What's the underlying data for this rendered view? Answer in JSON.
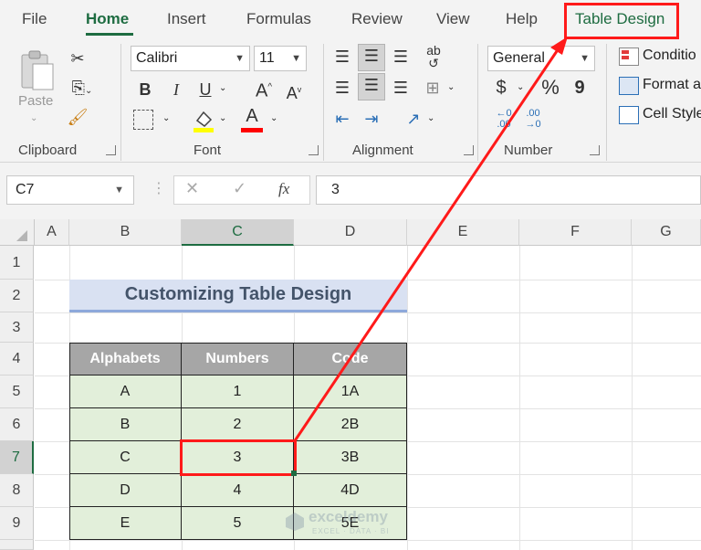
{
  "tabs": [
    {
      "label": "File"
    },
    {
      "label": "Home"
    },
    {
      "label": "Insert"
    },
    {
      "label": "Formulas"
    },
    {
      "label": "Review"
    },
    {
      "label": "View"
    },
    {
      "label": "Help"
    },
    {
      "label": "Table Design"
    }
  ],
  "ribbon": {
    "clipboard": {
      "paste_label": "Paste",
      "group_label": "Clipboard"
    },
    "font": {
      "font_name": "Calibri",
      "font_size": "11",
      "bold": "B",
      "italic": "I",
      "underline": "U",
      "grow": "A",
      "shrink": "A",
      "font_color": "A",
      "group_label": "Font"
    },
    "alignment": {
      "group_label": "Alignment"
    },
    "number": {
      "format": "General",
      "currency": "$",
      "percent": "%",
      "comma": "9",
      "inc_decimal": "←0 .00",
      "dec_decimal": ".00 →0",
      "group_label": "Number"
    },
    "styles": {
      "conditional": "Conditio",
      "format_as": "Format a",
      "cell_styles": "Cell Style"
    }
  },
  "formula_bar": {
    "name_box": "C7",
    "fx": "fx",
    "value": "3"
  },
  "columns": [
    "A",
    "B",
    "C",
    "D",
    "E",
    "F",
    "G"
  ],
  "rows": [
    "1",
    "2",
    "3",
    "4",
    "5",
    "6",
    "7",
    "8",
    "9"
  ],
  "sheet": {
    "title": "Customizing Table Design",
    "headers": [
      "Alphabets",
      "Numbers",
      "Code"
    ],
    "data": [
      [
        "A",
        "1",
        "1A"
      ],
      [
        "B",
        "2",
        "2B"
      ],
      [
        "C",
        "3",
        "3B"
      ],
      [
        "D",
        "4",
        "4D"
      ],
      [
        "E",
        "5",
        "5E"
      ]
    ]
  },
  "watermark": {
    "brand": "exceldemy",
    "tagline": "EXCEL · DATA · BI"
  },
  "colors": {
    "accent": "#1e6c41",
    "highlight": "#ff1a1a",
    "header_fill": "#a6a6a6",
    "body_fill": "#e2efda",
    "title_fill": "#d9e1f2"
  }
}
